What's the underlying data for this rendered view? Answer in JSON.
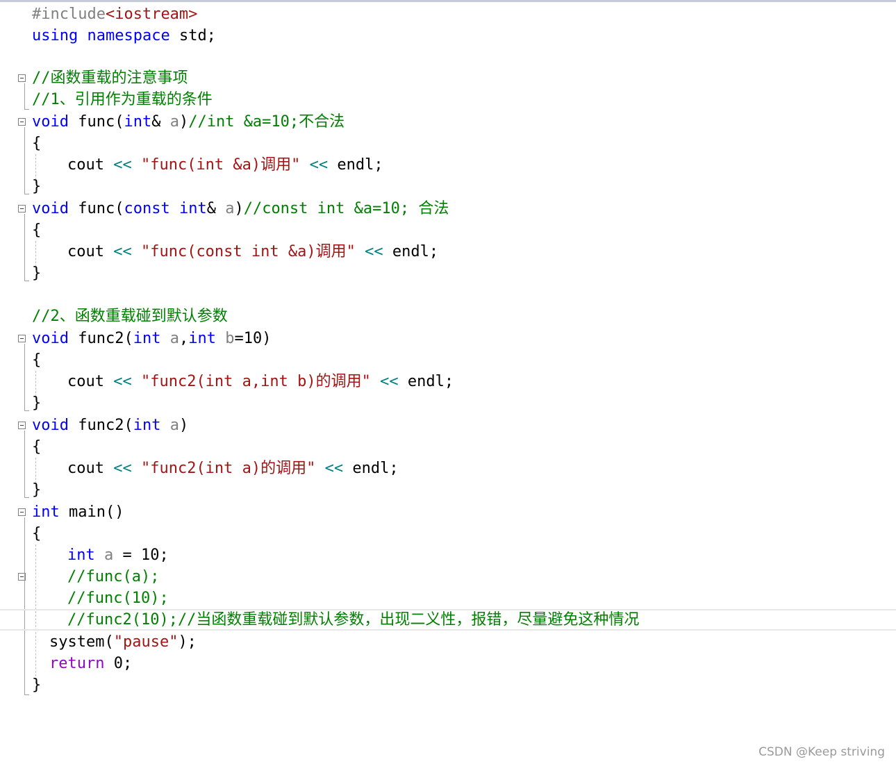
{
  "editor": {
    "lines": [
      {
        "id": "l1",
        "segments": [
          {
            "t": "#include",
            "c": "pp"
          },
          {
            "t": "<iostream>",
            "c": "inc"
          }
        ]
      },
      {
        "id": "l2",
        "segments": [
          {
            "t": "using",
            "c": "kw"
          },
          {
            "t": " ",
            "c": "pun"
          },
          {
            "t": "namespace",
            "c": "kw"
          },
          {
            "t": " std;",
            "c": "pun"
          }
        ]
      },
      {
        "id": "l3",
        "segments": []
      },
      {
        "id": "l4",
        "segments": [
          {
            "t": "//函数重载的注意事项",
            "c": "cm"
          }
        ]
      },
      {
        "id": "l5",
        "segments": [
          {
            "t": "//1、引用作为重载的条件",
            "c": "cm"
          }
        ]
      },
      {
        "id": "l6",
        "segments": [
          {
            "t": "void",
            "c": "kw"
          },
          {
            "t": " func(",
            "c": "fn"
          },
          {
            "t": "int",
            "c": "kw"
          },
          {
            "t": "& ",
            "c": "pun"
          },
          {
            "t": "a",
            "c": "var"
          },
          {
            "t": ")",
            "c": "pun"
          },
          {
            "t": "//int &a=10;不合法",
            "c": "cm"
          }
        ]
      },
      {
        "id": "l7",
        "segments": [
          {
            "t": "{",
            "c": "pun"
          }
        ]
      },
      {
        "id": "l8",
        "indent": 1,
        "segments": [
          {
            "t": "cout",
            "c": "fn"
          },
          {
            "t": " << ",
            "c": "op"
          },
          {
            "t": "\"func(int &a)调用\"",
            "c": "str"
          },
          {
            "t": " << ",
            "c": "op"
          },
          {
            "t": "endl;",
            "c": "fn"
          }
        ]
      },
      {
        "id": "l9",
        "segments": [
          {
            "t": "}",
            "c": "pun"
          }
        ]
      },
      {
        "id": "l10",
        "segments": [
          {
            "t": "void",
            "c": "kw"
          },
          {
            "t": " func(",
            "c": "fn"
          },
          {
            "t": "const",
            "c": "kw"
          },
          {
            "t": " ",
            "c": "pun"
          },
          {
            "t": "int",
            "c": "kw"
          },
          {
            "t": "& ",
            "c": "pun"
          },
          {
            "t": "a",
            "c": "var"
          },
          {
            "t": ")",
            "c": "pun"
          },
          {
            "t": "//const int &a=10; 合法",
            "c": "cm"
          }
        ]
      },
      {
        "id": "l11",
        "segments": [
          {
            "t": "{",
            "c": "pun"
          }
        ]
      },
      {
        "id": "l12",
        "indent": 1,
        "segments": [
          {
            "t": "cout",
            "c": "fn"
          },
          {
            "t": " << ",
            "c": "op"
          },
          {
            "t": "\"func(const int &a)调用\"",
            "c": "str"
          },
          {
            "t": " << ",
            "c": "op"
          },
          {
            "t": "endl;",
            "c": "fn"
          }
        ]
      },
      {
        "id": "l13",
        "segments": [
          {
            "t": "}",
            "c": "pun"
          }
        ]
      },
      {
        "id": "l14",
        "segments": []
      },
      {
        "id": "l15",
        "segments": [
          {
            "t": "//2、函数重载碰到默认参数",
            "c": "cm"
          }
        ]
      },
      {
        "id": "l16",
        "segments": [
          {
            "t": "void",
            "c": "kw"
          },
          {
            "t": " func2(",
            "c": "fn"
          },
          {
            "t": "int",
            "c": "kw"
          },
          {
            "t": " ",
            "c": "pun"
          },
          {
            "t": "a",
            "c": "var"
          },
          {
            "t": ",",
            "c": "pun"
          },
          {
            "t": "int",
            "c": "kw"
          },
          {
            "t": " ",
            "c": "pun"
          },
          {
            "t": "b",
            "c": "var"
          },
          {
            "t": "=10)",
            "c": "pun"
          }
        ]
      },
      {
        "id": "l17",
        "segments": [
          {
            "t": "{",
            "c": "pun"
          }
        ]
      },
      {
        "id": "l18",
        "indent": 1,
        "segments": [
          {
            "t": "cout",
            "c": "fn"
          },
          {
            "t": " << ",
            "c": "op"
          },
          {
            "t": "\"func2(int a,int b)的调用\"",
            "c": "str"
          },
          {
            "t": " << ",
            "c": "op"
          },
          {
            "t": "endl;",
            "c": "fn"
          }
        ]
      },
      {
        "id": "l19",
        "segments": [
          {
            "t": "}",
            "c": "pun"
          }
        ]
      },
      {
        "id": "l20",
        "segments": [
          {
            "t": "void",
            "c": "kw"
          },
          {
            "t": " func2(",
            "c": "fn"
          },
          {
            "t": "int",
            "c": "kw"
          },
          {
            "t": " ",
            "c": "pun"
          },
          {
            "t": "a",
            "c": "var"
          },
          {
            "t": ")",
            "c": "pun"
          }
        ]
      },
      {
        "id": "l21",
        "segments": [
          {
            "t": "{",
            "c": "pun"
          }
        ]
      },
      {
        "id": "l22",
        "indent": 1,
        "segments": [
          {
            "t": "cout",
            "c": "fn"
          },
          {
            "t": " << ",
            "c": "op"
          },
          {
            "t": "\"func2(int a)的调用\"",
            "c": "str"
          },
          {
            "t": " << ",
            "c": "op"
          },
          {
            "t": "endl;",
            "c": "fn"
          }
        ]
      },
      {
        "id": "l23",
        "segments": [
          {
            "t": "}",
            "c": "pun"
          }
        ]
      },
      {
        "id": "l24",
        "segments": [
          {
            "t": "int",
            "c": "kw"
          },
          {
            "t": " main()",
            "c": "fn"
          }
        ]
      },
      {
        "id": "l25",
        "segments": [
          {
            "t": "{",
            "c": "pun"
          }
        ]
      },
      {
        "id": "l26",
        "indent": 1,
        "segments": [
          {
            "t": "int",
            "c": "kw"
          },
          {
            "t": " ",
            "c": "pun"
          },
          {
            "t": "a",
            "c": "var"
          },
          {
            "t": " = 10;",
            "c": "pun"
          }
        ]
      },
      {
        "id": "l27",
        "indent": 1,
        "segments": [
          {
            "t": "//func(a);",
            "c": "cm"
          }
        ]
      },
      {
        "id": "l28",
        "indent": 1,
        "segments": [
          {
            "t": "//func(10);",
            "c": "cm"
          }
        ]
      },
      {
        "id": "l29",
        "indent": 1,
        "current": true,
        "segments": [
          {
            "t": "//func2(10);//当函数重载碰到默认参数，出现二义性，报错，尽量避免这种情况",
            "c": "cm"
          }
        ]
      },
      {
        "id": "l30",
        "indent": 0.5,
        "segments": [
          {
            "t": "system(",
            "c": "fn"
          },
          {
            "t": "\"pause\"",
            "c": "str"
          },
          {
            "t": ");",
            "c": "pun"
          }
        ]
      },
      {
        "id": "l31",
        "indent": 0.5,
        "segments": [
          {
            "t": "return",
            "c": "ctl"
          },
          {
            "t": " 0;",
            "c": "pun"
          }
        ]
      },
      {
        "id": "l32",
        "segments": [
          {
            "t": "}",
            "c": "pun"
          }
        ]
      }
    ]
  },
  "watermark": "CSDN @Keep striving",
  "colors": {
    "keyword": "#0000ff",
    "preprocessor": "#808080",
    "include_target": "#a31515",
    "comment": "#008000",
    "string": "#a31515",
    "control_keyword": "#8f08c4",
    "operator": "#008080",
    "parameter": "#808080"
  },
  "icons": {
    "fold": "collapse-minus-icon"
  }
}
